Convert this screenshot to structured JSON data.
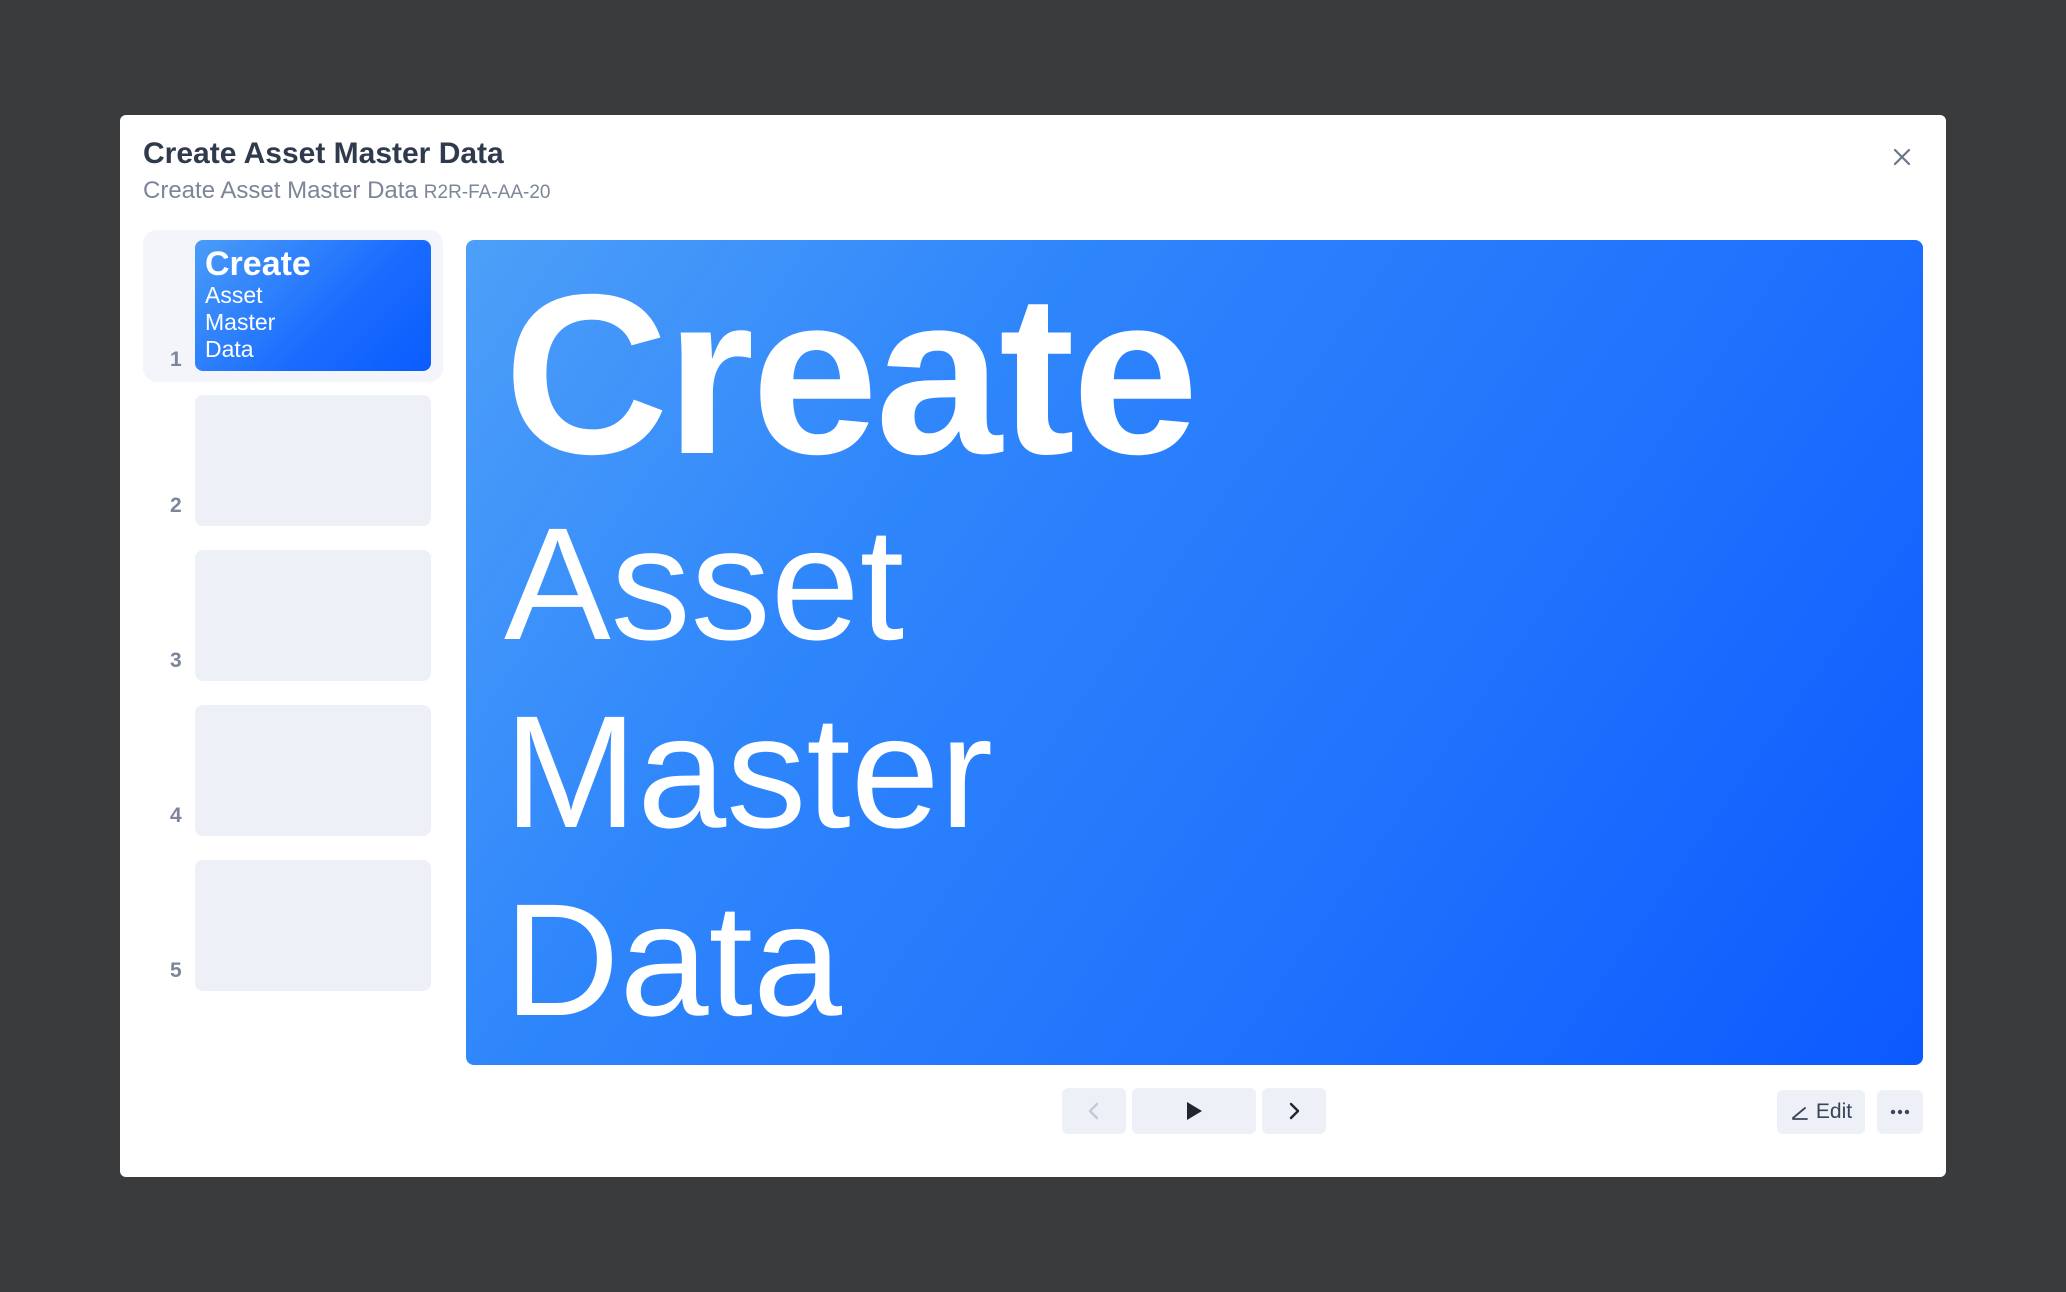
{
  "modal": {
    "title": "Create Asset Master Data",
    "subtitle": "Create Asset Master Data",
    "code": "R2R-FA-AA-20"
  },
  "thumbnails": [
    {
      "number": "1",
      "active": true,
      "head": "Create",
      "lines": [
        "Asset",
        "Master",
        "Data"
      ]
    },
    {
      "number": "2",
      "active": false
    },
    {
      "number": "3",
      "active": false
    },
    {
      "number": "4",
      "active": false
    },
    {
      "number": "5",
      "active": false
    }
  ],
  "slide": {
    "head": "Create",
    "lines": [
      "Asset",
      "Master",
      "Data"
    ]
  },
  "controls": {
    "edit_label": "Edit",
    "prev_icon": "chevron-left-icon",
    "play_icon": "play-icon",
    "next_icon": "chevron-right-icon",
    "more_icon": "more-horizontal-icon",
    "edit_icon": "pencil-icon"
  },
  "colors": {
    "backdrop": "#3a3b3d",
    "slide_gradient_start": "#4d9ff8",
    "slide_gradient_end": "#0b5aff",
    "title_text": "#2f3a4c",
    "muted_text": "#7c8698",
    "button_bg": "#edf0f7"
  }
}
